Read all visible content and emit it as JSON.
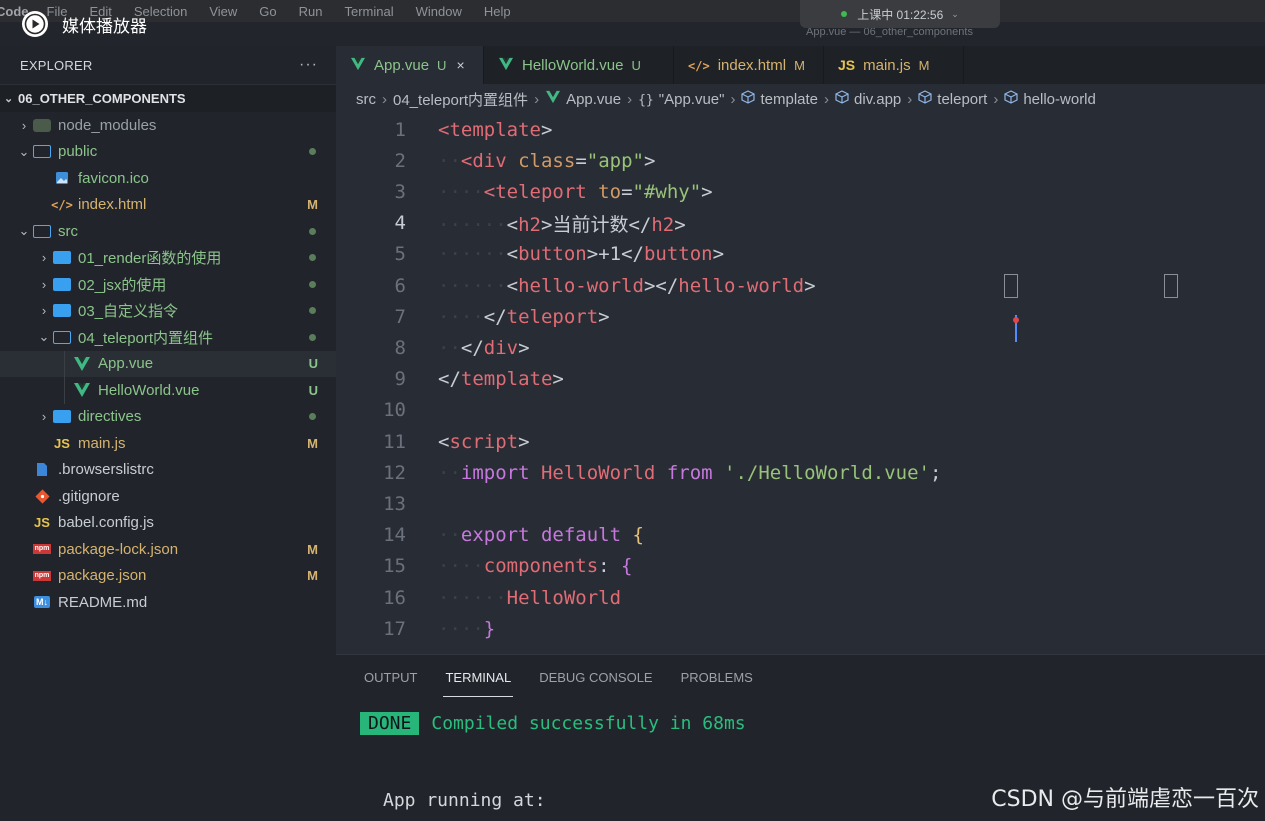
{
  "menubar": {
    "app_name": "Code",
    "items": [
      "File",
      "Edit",
      "Selection",
      "View",
      "Go",
      "Run",
      "Terminal",
      "Window",
      "Help"
    ]
  },
  "window_title": "App.vue — 06_other_components",
  "clock": {
    "label": "上课中 01:22:56"
  },
  "media_overlay": {
    "label": "媒体播放器"
  },
  "sidebar": {
    "title": "EXPLORER",
    "more": "···",
    "project": "06_OTHER_COMPONENTS",
    "items": [
      {
        "name": "node_modules",
        "depth": 1,
        "kind": "folder-node",
        "caret": "›",
        "color": "dim"
      },
      {
        "name": "public",
        "depth": 1,
        "kind": "folder-open",
        "caret": "⌄",
        "color": "green",
        "dot": true
      },
      {
        "name": "favicon.ico",
        "depth": 2,
        "kind": "image",
        "caret": "",
        "color": "green"
      },
      {
        "name": "index.html",
        "depth": 2,
        "kind": "html",
        "caret": "",
        "color": "mod",
        "badge": "M"
      },
      {
        "name": "src",
        "depth": 1,
        "kind": "folder-open",
        "caret": "⌄",
        "color": "green",
        "dot": true
      },
      {
        "name": "01_render函数的使用",
        "depth": 2,
        "kind": "folder",
        "caret": "›",
        "color": "green",
        "dot": true
      },
      {
        "name": "02_jsx的使用",
        "depth": 2,
        "kind": "folder",
        "caret": "›",
        "color": "green",
        "dot": true
      },
      {
        "name": "03_自定义指令",
        "depth": 2,
        "kind": "folder",
        "caret": "›",
        "color": "green",
        "dot": true
      },
      {
        "name": "04_teleport内置组件",
        "depth": 2,
        "kind": "folder-open",
        "caret": "⌄",
        "color": "green",
        "dot": true
      },
      {
        "name": "App.vue",
        "depth": 3,
        "kind": "vue",
        "caret": "",
        "color": "green",
        "badge": "U",
        "active": true
      },
      {
        "name": "HelloWorld.vue",
        "depth": 3,
        "kind": "vue",
        "caret": "",
        "color": "green",
        "badge": "U"
      },
      {
        "name": "directives",
        "depth": 2,
        "kind": "folder",
        "caret": "›",
        "color": "green",
        "dot": true
      },
      {
        "name": "main.js",
        "depth": 2,
        "kind": "js",
        "caret": "",
        "color": "mod",
        "badge": "M"
      },
      {
        "name": ".browserslistrc",
        "depth": 1,
        "kind": "file",
        "caret": "",
        "color": "white"
      },
      {
        "name": ".gitignore",
        "depth": 1,
        "kind": "git",
        "caret": "",
        "color": "white"
      },
      {
        "name": "babel.config.js",
        "depth": 1,
        "kind": "js",
        "caret": "",
        "color": "white"
      },
      {
        "name": "package-lock.json",
        "depth": 1,
        "kind": "npm",
        "caret": "",
        "color": "mod",
        "badge": "M"
      },
      {
        "name": "package.json",
        "depth": 1,
        "kind": "npm",
        "caret": "",
        "color": "mod",
        "badge": "M"
      },
      {
        "name": "README.md",
        "depth": 1,
        "kind": "md",
        "caret": "",
        "color": "white"
      }
    ]
  },
  "tabs": [
    {
      "label": "App.vue",
      "status": "U",
      "icon": "vue",
      "active": true,
      "close": "×"
    },
    {
      "label": "HelloWorld.vue",
      "status": "U",
      "icon": "vue",
      "active": false
    },
    {
      "label": "index.html",
      "status": "M",
      "icon": "html",
      "active": false
    },
    {
      "label": "main.js",
      "status": "M",
      "icon": "js",
      "active": false
    }
  ],
  "breadcrumb": [
    "src",
    "04_teleport内置组件",
    "App.vue",
    "\"App.vue\"",
    "template",
    "div.app",
    "teleport",
    "hello-world"
  ],
  "editor": {
    "current_line": 4,
    "lines": [
      {
        "n": "1",
        "indent": 0,
        "tokens": [
          [
            "tag",
            "<template"
          ],
          [
            "punc",
            ">"
          ]
        ]
      },
      {
        "n": "2",
        "indent": 1,
        "tokens": [
          [
            "tag",
            "<div"
          ],
          [
            "txt",
            " "
          ],
          [
            "attr",
            "class"
          ],
          [
            "punc",
            "="
          ],
          [
            "str",
            "\"app\""
          ],
          [
            "punc",
            ">"
          ]
        ]
      },
      {
        "n": "3",
        "indent": 2,
        "tokens": [
          [
            "tag",
            "<teleport"
          ],
          [
            "txt",
            " "
          ],
          [
            "attr",
            "to"
          ],
          [
            "punc",
            "="
          ],
          [
            "str",
            "\"#why\""
          ],
          [
            "punc",
            ">"
          ]
        ]
      },
      {
        "n": "4",
        "indent": 3,
        "tokens": [
          [
            "punc",
            "<"
          ],
          [
            "tag",
            "h2"
          ],
          [
            "punc",
            ">"
          ],
          [
            "txt",
            "当前计数"
          ],
          [
            "punc",
            "</"
          ],
          [
            "tag",
            "h2"
          ],
          [
            "punc",
            ">"
          ]
        ]
      },
      {
        "n": "5",
        "indent": 3,
        "tokens": [
          [
            "punc",
            "<"
          ],
          [
            "tag",
            "button"
          ],
          [
            "punc",
            ">"
          ],
          [
            "txt",
            "+1"
          ],
          [
            "punc",
            "</"
          ],
          [
            "tag",
            "button"
          ],
          [
            "punc",
            ">"
          ]
        ]
      },
      {
        "n": "6",
        "indent": 3,
        "tokens": [
          [
            "punc",
            "<"
          ],
          [
            "tag",
            "hello-world"
          ],
          [
            "punc",
            ">"
          ],
          [
            "punc",
            "</"
          ],
          [
            "tag",
            "hello-world"
          ],
          [
            "punc",
            ">"
          ]
        ]
      },
      {
        "n": "7",
        "indent": 2,
        "tokens": [
          [
            "punc",
            "</"
          ],
          [
            "tag",
            "teleport"
          ],
          [
            "punc",
            ">"
          ]
        ]
      },
      {
        "n": "8",
        "indent": 1,
        "tokens": [
          [
            "punc",
            "</"
          ],
          [
            "tag",
            "div"
          ],
          [
            "punc",
            ">"
          ]
        ]
      },
      {
        "n": "9",
        "indent": 0,
        "tokens": [
          [
            "punc",
            "</"
          ],
          [
            "tag",
            "template"
          ],
          [
            "punc",
            ">"
          ]
        ]
      },
      {
        "n": "10",
        "indent": 0,
        "tokens": []
      },
      {
        "n": "11",
        "indent": 0,
        "tokens": [
          [
            "punc",
            "<"
          ],
          [
            "tag",
            "script"
          ],
          [
            "punc",
            ">"
          ]
        ]
      },
      {
        "n": "12",
        "indent": 1,
        "tokens": [
          [
            "key",
            "import"
          ],
          [
            "txt",
            " "
          ],
          [
            "var",
            "HelloWorld"
          ],
          [
            "txt",
            " "
          ],
          [
            "key",
            "from"
          ],
          [
            "txt",
            " "
          ],
          [
            "str",
            "'./HelloWorld.vue'"
          ],
          [
            "punc",
            ";"
          ]
        ]
      },
      {
        "n": "13",
        "indent": 0,
        "tokens": []
      },
      {
        "n": "14",
        "indent": 1,
        "tokens": [
          [
            "key",
            "export"
          ],
          [
            "txt",
            " "
          ],
          [
            "key",
            "default"
          ],
          [
            "txt",
            " "
          ],
          [
            "brace",
            "{"
          ]
        ]
      },
      {
        "n": "15",
        "indent": 2,
        "tokens": [
          [
            "var",
            "components"
          ],
          [
            "punc",
            ": "
          ],
          [
            "brace2",
            "{"
          ]
        ]
      },
      {
        "n": "16",
        "indent": 3,
        "tokens": [
          [
            "var",
            "HelloWorld"
          ]
        ]
      },
      {
        "n": "17",
        "indent": 2,
        "tokens": [
          [
            "brace2",
            "}"
          ]
        ]
      }
    ]
  },
  "panel": {
    "tabs": [
      {
        "label": "OUTPUT",
        "active": false
      },
      {
        "label": "TERMINAL",
        "active": true
      },
      {
        "label": "DEBUG CONSOLE",
        "active": false
      },
      {
        "label": "PROBLEMS",
        "active": false
      }
    ],
    "done_badge": "DONE",
    "compiled_msg": "Compiled successfully in 68ms",
    "running_msg": "App running at:"
  },
  "watermark": "CSDN @与前端虐恋一百次",
  "colors": {
    "editor_bg": "#282c34",
    "sidebar_bg": "#21252b",
    "git_untracked": "#8bc48a",
    "git_modified": "#d5b36f",
    "terminal_done": "#27b57a"
  }
}
